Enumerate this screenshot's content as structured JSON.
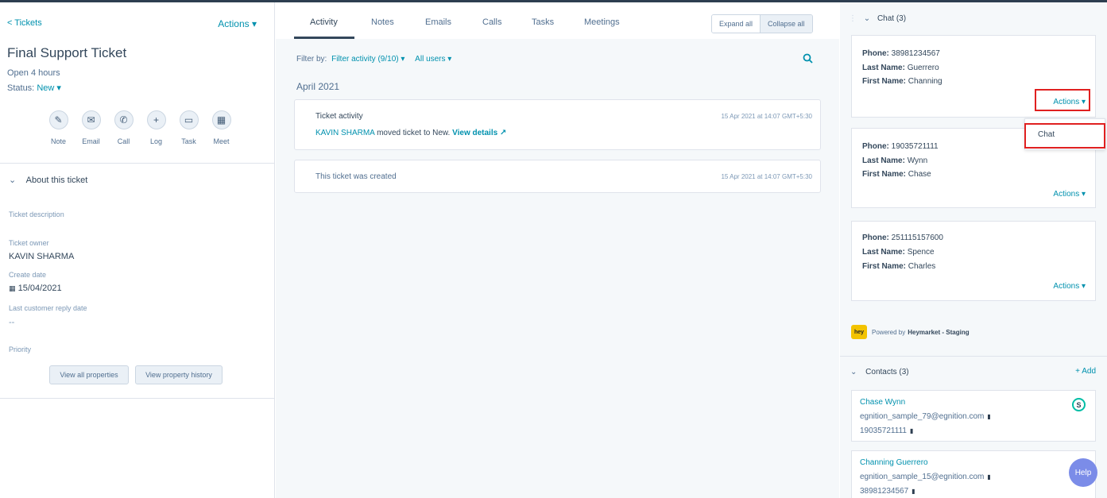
{
  "left": {
    "back_label": "< Tickets",
    "actions_label": "Actions ▾",
    "title": "Final Support Ticket",
    "open": "Open 4 hours",
    "status_label": "Status:",
    "status_value": "New ▾",
    "actions": [
      {
        "label": "Note",
        "icon": "✎"
      },
      {
        "label": "Email",
        "icon": "✉"
      },
      {
        "label": "Call",
        "icon": "✆"
      },
      {
        "label": "Log",
        "icon": "+"
      },
      {
        "label": "Task",
        "icon": "▭"
      },
      {
        "label": "Meet",
        "icon": "▦"
      }
    ],
    "about_chevron": "⌄",
    "about_title": "About this ticket",
    "ticket_description_label": "Ticket description",
    "ticket_owner_label": "Ticket owner",
    "ticket_owner_value": "KAVIN SHARMA",
    "create_date_label": "Create date",
    "create_date_value": "15/04/2021",
    "last_reply_label": "Last customer reply date",
    "last_reply_value": "--",
    "priority_label": "Priority",
    "view_all_btn": "View all properties",
    "view_history_btn": "View property history"
  },
  "middle": {
    "tabs": [
      "Activity",
      "Notes",
      "Emails",
      "Calls",
      "Tasks",
      "Meetings"
    ],
    "expand_all": "Expand all",
    "collapse_all": "Collapse all",
    "filter_by": "Filter by:",
    "filter_activity": "Filter activity (9/10) ▾",
    "all_users": "All users ▾",
    "month": "April 2021",
    "cards": [
      {
        "heading": "Ticket activity",
        "time": "15 Apr 2021 at 14:07 GMT+5:30",
        "actor": "KAVIN SHARMA",
        "text": "moved ticket to New.",
        "link": "View details ↗"
      },
      {
        "heading": "This ticket was created",
        "time": "15 Apr 2021 at 14:07 GMT+5:30"
      }
    ]
  },
  "right": {
    "chat_header": "Chat (3)",
    "chat_cards": [
      {
        "phone": "38981234567",
        "last": "Guerrero",
        "first": "Channing",
        "actions": "Actions ▾"
      },
      {
        "phone": "19035721111",
        "last": "Wynn",
        "first": "Chase",
        "actions": "Actions ▾"
      },
      {
        "phone": "251115157600",
        "last": "Spence",
        "first": "Charles",
        "actions": "Actions ▾"
      }
    ],
    "phone_label": "Phone:",
    "last_label": "Last Name:",
    "first_label": "First Name:",
    "dropdown_item": "Chat",
    "powered_prefix": "Powered by",
    "powered_name": "Heymarket - Staging",
    "hey_logo": "hey",
    "contacts_header": "Contacts (3)",
    "add_label": "+ Add",
    "contacts": [
      {
        "name": "Chase Wynn",
        "email": "egnition_sample_79@egnition.com",
        "phone": "19035721111"
      },
      {
        "name": "Channing Guerrero",
        "email": "egnition_sample_15@egnition.com",
        "phone": "38981234567"
      }
    ],
    "s_badge": "S",
    "help": "Help"
  },
  "colors": {
    "accent": "#0091ae",
    "highlight": "#e02020",
    "text": "#33475b"
  }
}
